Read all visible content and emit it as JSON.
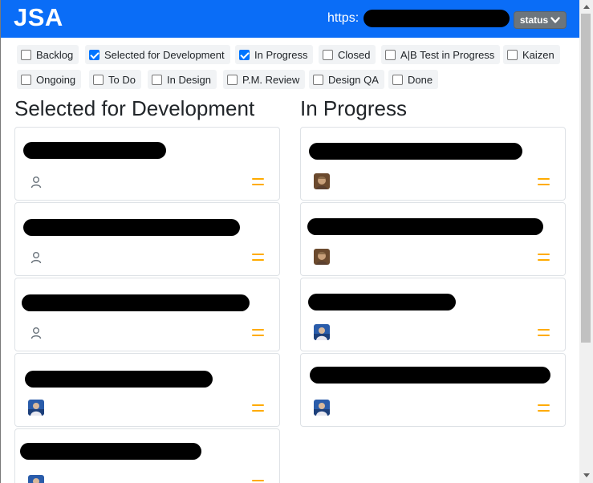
{
  "header": {
    "brand": "JSA",
    "url_prefix": "https:",
    "status_button": "status"
  },
  "filters": [
    {
      "label": "Backlog",
      "checked": false
    },
    {
      "label": "Selected for Development",
      "checked": true
    },
    {
      "label": "In Progress",
      "checked": true
    },
    {
      "label": "Closed",
      "checked": false
    },
    {
      "label": "A|B Test in Progress",
      "checked": false
    },
    {
      "label": "Kaizen",
      "checked": false
    },
    {
      "label": "Ongoing",
      "checked": false
    },
    {
      "label": "To Do",
      "checked": false
    },
    {
      "label": "In Design",
      "checked": false
    },
    {
      "label": "P.M. Review",
      "checked": false
    },
    {
      "label": "Design QA",
      "checked": false
    },
    {
      "label": "Done",
      "checked": false
    }
  ],
  "columns": [
    {
      "title": "Selected for Development",
      "cards": [
        {
          "assignee": "unassigned",
          "priority": "medium"
        },
        {
          "assignee": "unassigned",
          "priority": "medium"
        },
        {
          "assignee": "unassigned",
          "priority": "medium"
        },
        {
          "assignee": "photo-blue",
          "priority": "medium"
        },
        {
          "assignee": "photo-blue",
          "priority": "medium"
        }
      ]
    },
    {
      "title": "In Progress",
      "cards": [
        {
          "assignee": "photo-brown",
          "priority": "medium"
        },
        {
          "assignee": "photo-brown",
          "priority": "medium"
        },
        {
          "assignee": "photo-blue",
          "priority": "medium"
        },
        {
          "assignee": "photo-blue",
          "priority": "medium"
        }
      ]
    }
  ],
  "colors": {
    "header": "#0a6df7",
    "priority": "#ffab00",
    "checkbox_checked": "#0075ff",
    "status_button": "#6c757d"
  }
}
